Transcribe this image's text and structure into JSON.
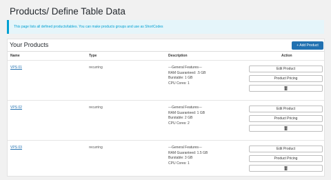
{
  "page": {
    "title": "Products/ Define Table Data",
    "notice": "This page lists all defined products/tables. You can make products groups and use as ShortCodes"
  },
  "panel": {
    "title": "Your Products",
    "add_button": "+ Add Product",
    "columns": {
      "name": "Name",
      "type": "Type",
      "description": "Description",
      "action": "Action"
    }
  },
  "products": [
    {
      "name": "VPS 01",
      "type": "recurring",
      "description": [
        "---General Features---",
        "RAM Guaranteed: .5 GB",
        "Burstable: 1 GB",
        "CPU Cores: 1"
      ],
      "edit": "Edit Product",
      "pricing": "Product Pricing"
    },
    {
      "name": "VPS 02",
      "type": "recurring",
      "description": [
        "---General Features---",
        "RAM Guaranteed: 1 GB",
        "Burstable: 2 GB",
        "CPU Cores: 2"
      ],
      "edit": "Edit Product",
      "pricing": "Product Pricing"
    },
    {
      "name": "VPS 03",
      "type": "recurring",
      "description": [
        "---General Features---",
        "RAM Guaranteed: 1.5 GB",
        "Burstable: 3 GB",
        "CPU Cores: 1"
      ],
      "edit": "Edit Product",
      "pricing": "Product Pricing"
    }
  ],
  "colors": {
    "accent": "#2271b1",
    "notice_text": "#00a0d2",
    "notice_bg": "#e5f5fa"
  },
  "icons": {
    "delete": "trash-icon"
  }
}
